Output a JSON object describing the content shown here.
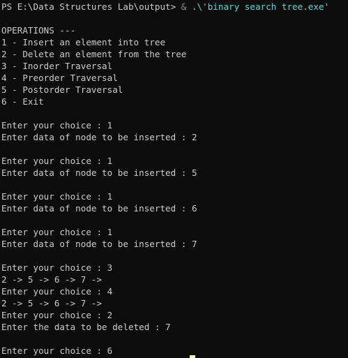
{
  "prompt": {
    "ps": "PS E:\\Data Structures Lab\\output> ",
    "amp": "& ",
    "path": ".\\'binary search tree.exe'"
  },
  "menu": {
    "title": "OPERATIONS ---",
    "items": [
      "1 - Insert an element into tree",
      "2 - Delete an element from the tree",
      "3 - Inorder Traversal",
      "4 - Preorder Traversal",
      "5 - Postorder Traversal",
      "6 - Exit"
    ]
  },
  "session": [
    "Enter your choice : 1",
    "Enter data of node to be inserted : 2",
    "",
    "Enter your choice : 1",
    "Enter data of node to be inserted : 5",
    "",
    "Enter your choice : 1",
    "Enter data of node to be inserted : 6",
    "",
    "Enter your choice : 1",
    "Enter data of node to be inserted : 7",
    "",
    "Enter your choice : 3",
    "2 -> 5 -> 6 -> 7 ->",
    "Enter your choice : 4",
    "2 -> 5 -> 6 -> 7 ->",
    "Enter your choice : 2",
    "Enter the data to be deleted : 7",
    "",
    "Enter your choice : 6"
  ],
  "colors": {
    "background": "#0c0c0c",
    "foreground": "#cccccc",
    "command": "#f9f1a5",
    "operator": "#8a8a8a",
    "string": "#61d6d6"
  }
}
